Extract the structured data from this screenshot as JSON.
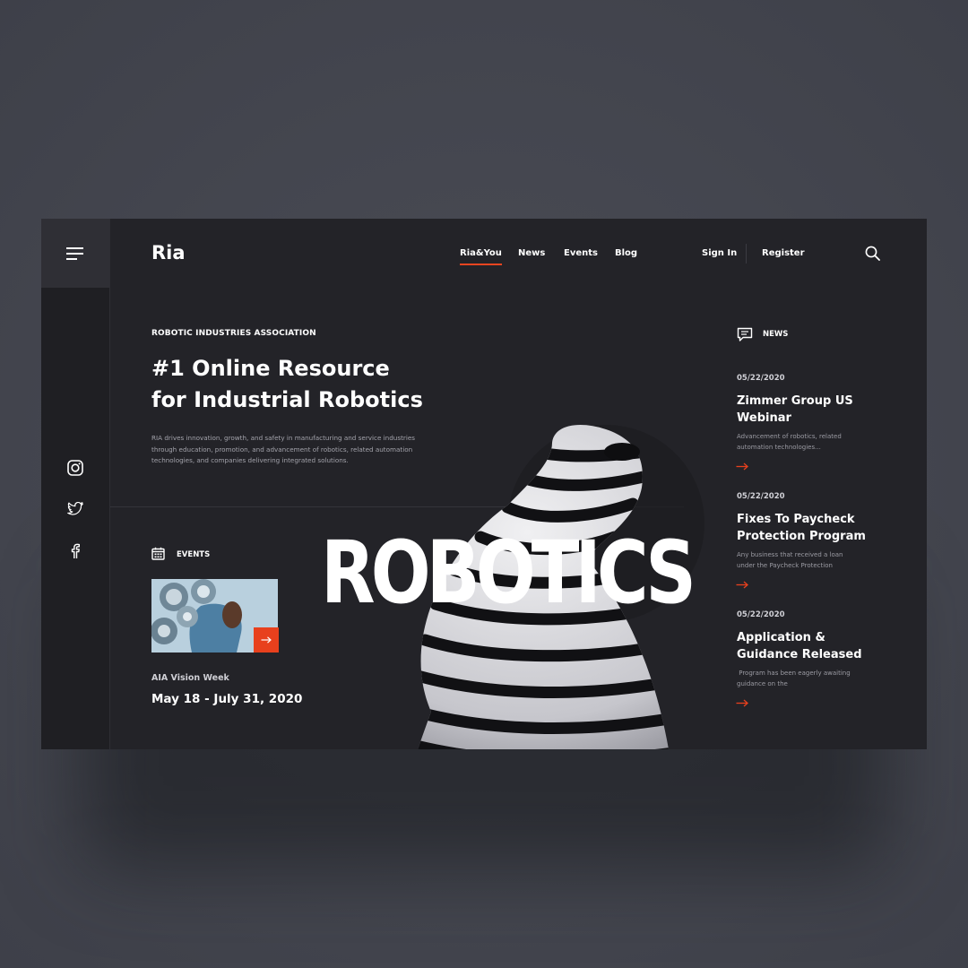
{
  "brand": {
    "name": "Ria"
  },
  "nav": {
    "items": [
      {
        "label": "Ria&You",
        "active": true
      },
      {
        "label": "News",
        "active": false
      },
      {
        "label": "Events",
        "active": false
      },
      {
        "label": "Blog",
        "active": false
      }
    ],
    "sign_in": "Sign In",
    "register": "Register"
  },
  "social": [
    "instagram-icon",
    "twitter-icon",
    "facebook-icon"
  ],
  "intro": {
    "eyebrow": "ROBOTIC INDUSTRIES ASSOCIATION",
    "headline_line1": "#1 Online Resource",
    "headline_line2": "for Industrial Robotics",
    "description": "RIA drives innovation, growth, and safety in manufacturing and service industries through education, promotion, and advancement of robotics, related automation technologies, and companies delivering integrated solutions."
  },
  "hero": {
    "word": "ROBOTICS"
  },
  "events": {
    "section_label": "EVENTS",
    "name": "AIA Vision Week",
    "date": "May 18 - July 31, 2020"
  },
  "news": {
    "section_label": "NEWS",
    "items": [
      {
        "date": "05/22/2020",
        "title": "Zimmer Group US Webinar",
        "desc": "Advancement of robotics, related automation technologies..."
      },
      {
        "date": "05/22/2020",
        "title": "Fixes To Paycheck Protection Program",
        "desc": "Any business that received a loan under the Paycheck Protection"
      },
      {
        "date": "05/22/2020",
        "title": "Application & Guidance Released",
        "desc": " Program has been eagerly awaiting guidance on the"
      }
    ]
  },
  "colors": {
    "accent": "#e8401d",
    "panel": "#232328",
    "sidebar": "#1f1f23",
    "backdrop": "#44464f"
  }
}
